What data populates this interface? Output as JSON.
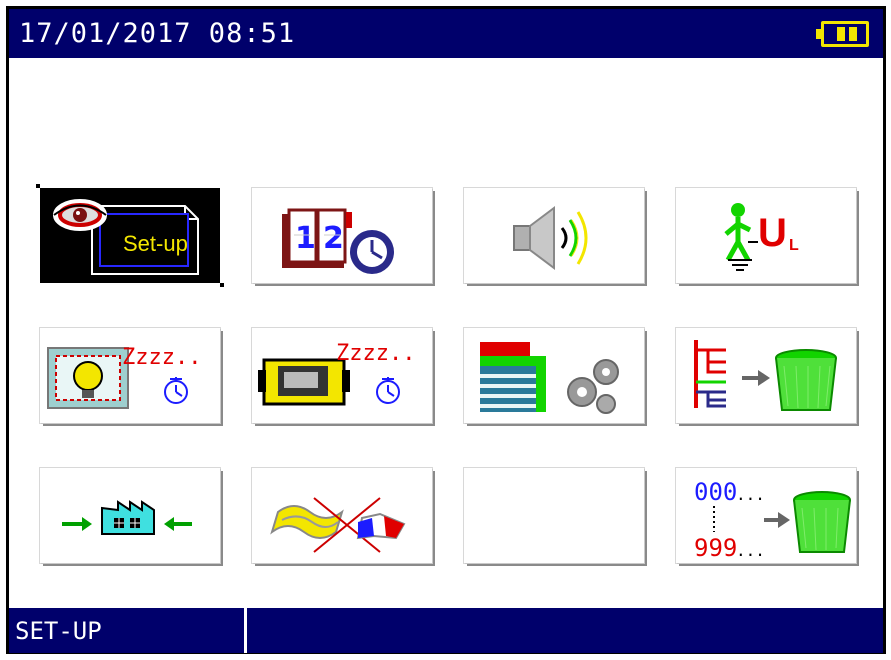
{
  "header": {
    "datetime": "17/01/2017 08:51",
    "battery_icon": "battery-icon"
  },
  "menu": {
    "tiles": [
      {
        "id": "setup",
        "label": "Set-up",
        "icon": "setup-icon",
        "selected": true
      },
      {
        "id": "date-time",
        "icon": "calendar-clock-icon",
        "digits": [
          "1",
          "2"
        ]
      },
      {
        "id": "sound",
        "icon": "speaker-icon"
      },
      {
        "id": "touch-voltage",
        "icon": "person-voltage-icon",
        "letter": "U",
        "subscript": "L"
      },
      {
        "id": "backlight-sleep",
        "icon": "backlight-sleep-icon",
        "sleep_text": "Zzzz.."
      },
      {
        "id": "instrument-sleep",
        "icon": "instrument-sleep-icon",
        "sleep_text": "Zzzz.."
      },
      {
        "id": "table-settings",
        "icon": "table-gears-icon"
      },
      {
        "id": "erase-tree",
        "icon": "tree-erase-icon"
      },
      {
        "id": "factory-reset",
        "icon": "factory-icon"
      },
      {
        "id": "language",
        "icon": "flags-icon"
      },
      {
        "id": "empty",
        "icon": ""
      },
      {
        "id": "erase-numbers",
        "icon": "numbers-erase-icon",
        "top": "000",
        "bottom": "999",
        "ellipsis": "..."
      }
    ]
  },
  "status": {
    "mode": "SET-UP",
    "value": ""
  },
  "colors": {
    "bar": "#00006b",
    "accent_yellow": "#f3e600",
    "red": "#e00000",
    "green": "#12d400"
  }
}
